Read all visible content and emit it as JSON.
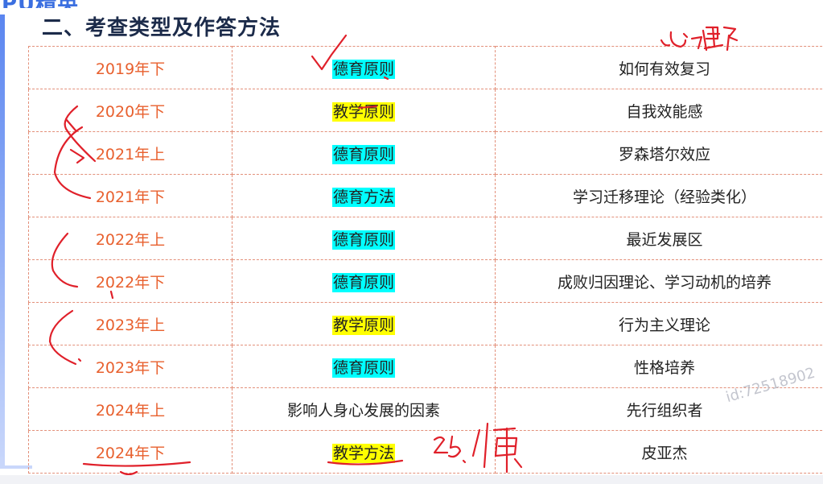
{
  "header": {
    "logo_text": "PU精英",
    "section_title": "二、考查类型及作答方法"
  },
  "rows": [
    {
      "year": "2019年下",
      "topic": "德育原则",
      "highlight": "cyan",
      "content": "如何有效复习"
    },
    {
      "year": "2020年下",
      "topic": "教学原则",
      "highlight": "yellow",
      "content": "自我效能感"
    },
    {
      "year": "2021年上",
      "topic": "德育原则",
      "highlight": "cyan",
      "content": "罗森塔尔效应"
    },
    {
      "year": "2021年下",
      "topic": "德育方法",
      "highlight": "cyan",
      "content": "学习迁移理论（经验类化）"
    },
    {
      "year": "2022年上",
      "topic": "德育原则",
      "highlight": "cyan",
      "content": "最近发展区"
    },
    {
      "year": "2022年下",
      "topic": "德育原则",
      "highlight": "cyan",
      "content": "成败归因理论、学习动机的培养"
    },
    {
      "year": "2023年上",
      "topic": "教学原则",
      "highlight": "yellow",
      "content": "行为主义理论"
    },
    {
      "year": "2023年下",
      "topic": "德育原则",
      "highlight": "cyan",
      "content": "性格培养"
    },
    {
      "year": "2024年上",
      "topic": "影响人身心发展的因素",
      "highlight": "none",
      "content": "先行组织者"
    },
    {
      "year": "2024年下",
      "topic": "教学方法",
      "highlight": "yellow",
      "content": "皮亚杰"
    }
  ],
  "annotations": {
    "handwriting_top": "心理",
    "handwriting_bottom": "25.懒",
    "ink_color": "#e0202a"
  },
  "watermark": "id:72518902",
  "colors": {
    "year_text": "#e8602e",
    "border": "#e3907a",
    "highlight_cyan": "#00ffff",
    "highlight_yellow": "#ffff00",
    "title": "#1c2b4a"
  }
}
